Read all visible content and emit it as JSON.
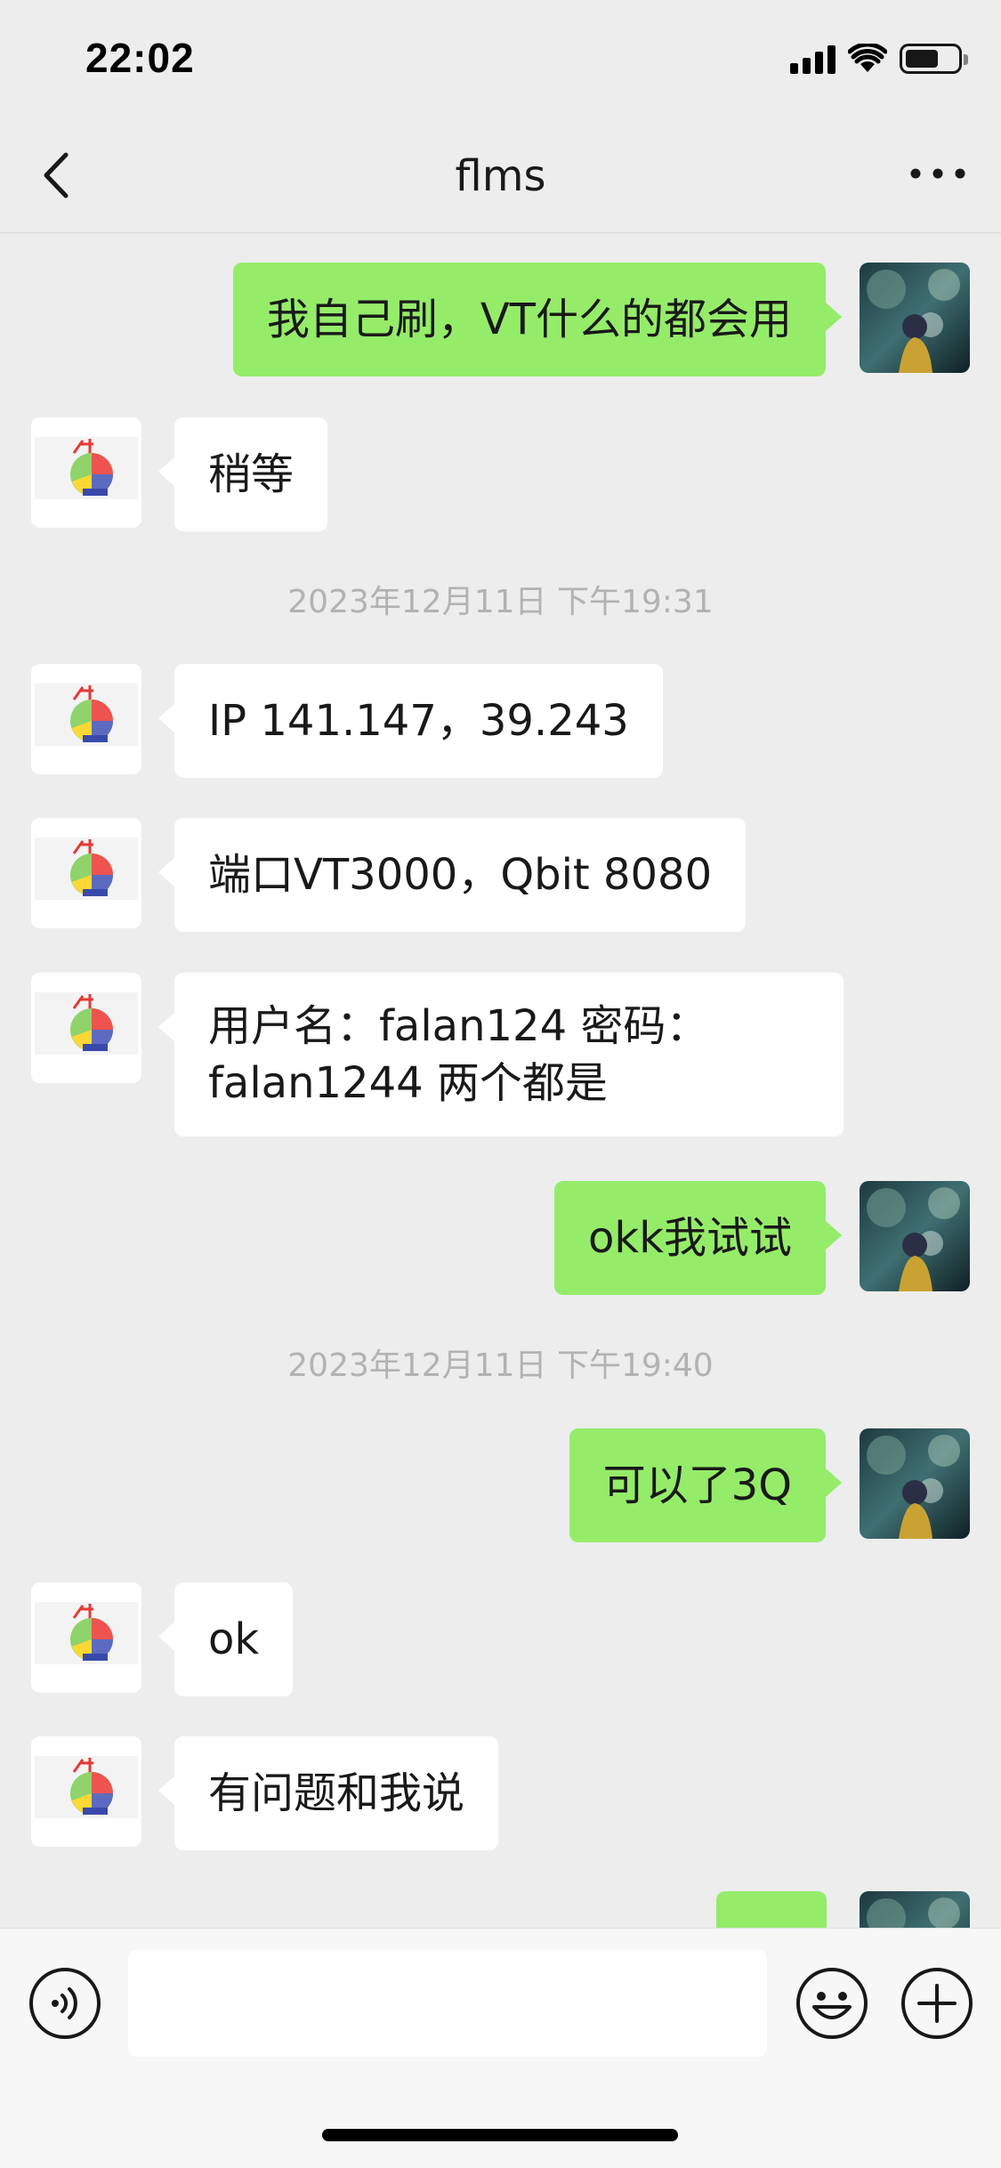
{
  "status_bar": {
    "time": "22:02",
    "signal_icon": "signal-bars-icon",
    "wifi_icon": "wifi-icon",
    "battery_icon": "battery-icon"
  },
  "nav": {
    "title": "flms",
    "back_icon": "chevron-left-icon",
    "more_icon": "more-dots-icon"
  },
  "messages": [
    {
      "from": "me",
      "text": "我自己刷，VT什么的都会用"
    },
    {
      "from": "them",
      "text": "稍等"
    },
    {
      "type": "timestamp",
      "text": "2023年12月11日 下午19:31"
    },
    {
      "from": "them",
      "text": "IP 141.147，39.243"
    },
    {
      "from": "them",
      "text": "端口VT3000，Qbit 8080"
    },
    {
      "from": "them",
      "text": "用户名：falan124 密码：falan1244 两个都是"
    },
    {
      "from": "me",
      "text": "okk我试试"
    },
    {
      "type": "timestamp",
      "text": "2023年12月11日 下午19:40"
    },
    {
      "from": "me",
      "text": "可以了3Q"
    },
    {
      "from": "them",
      "text": "ok"
    },
    {
      "from": "them",
      "text": "有问题和我说"
    }
  ],
  "input_bar": {
    "voice_icon": "voice-icon",
    "emoji_icon": "emoji-icon",
    "plus_icon": "plus-icon",
    "input_value": ""
  },
  "colors": {
    "my_bubble": "#95ec69",
    "their_bubble": "#ffffff",
    "background": "#ededed"
  }
}
